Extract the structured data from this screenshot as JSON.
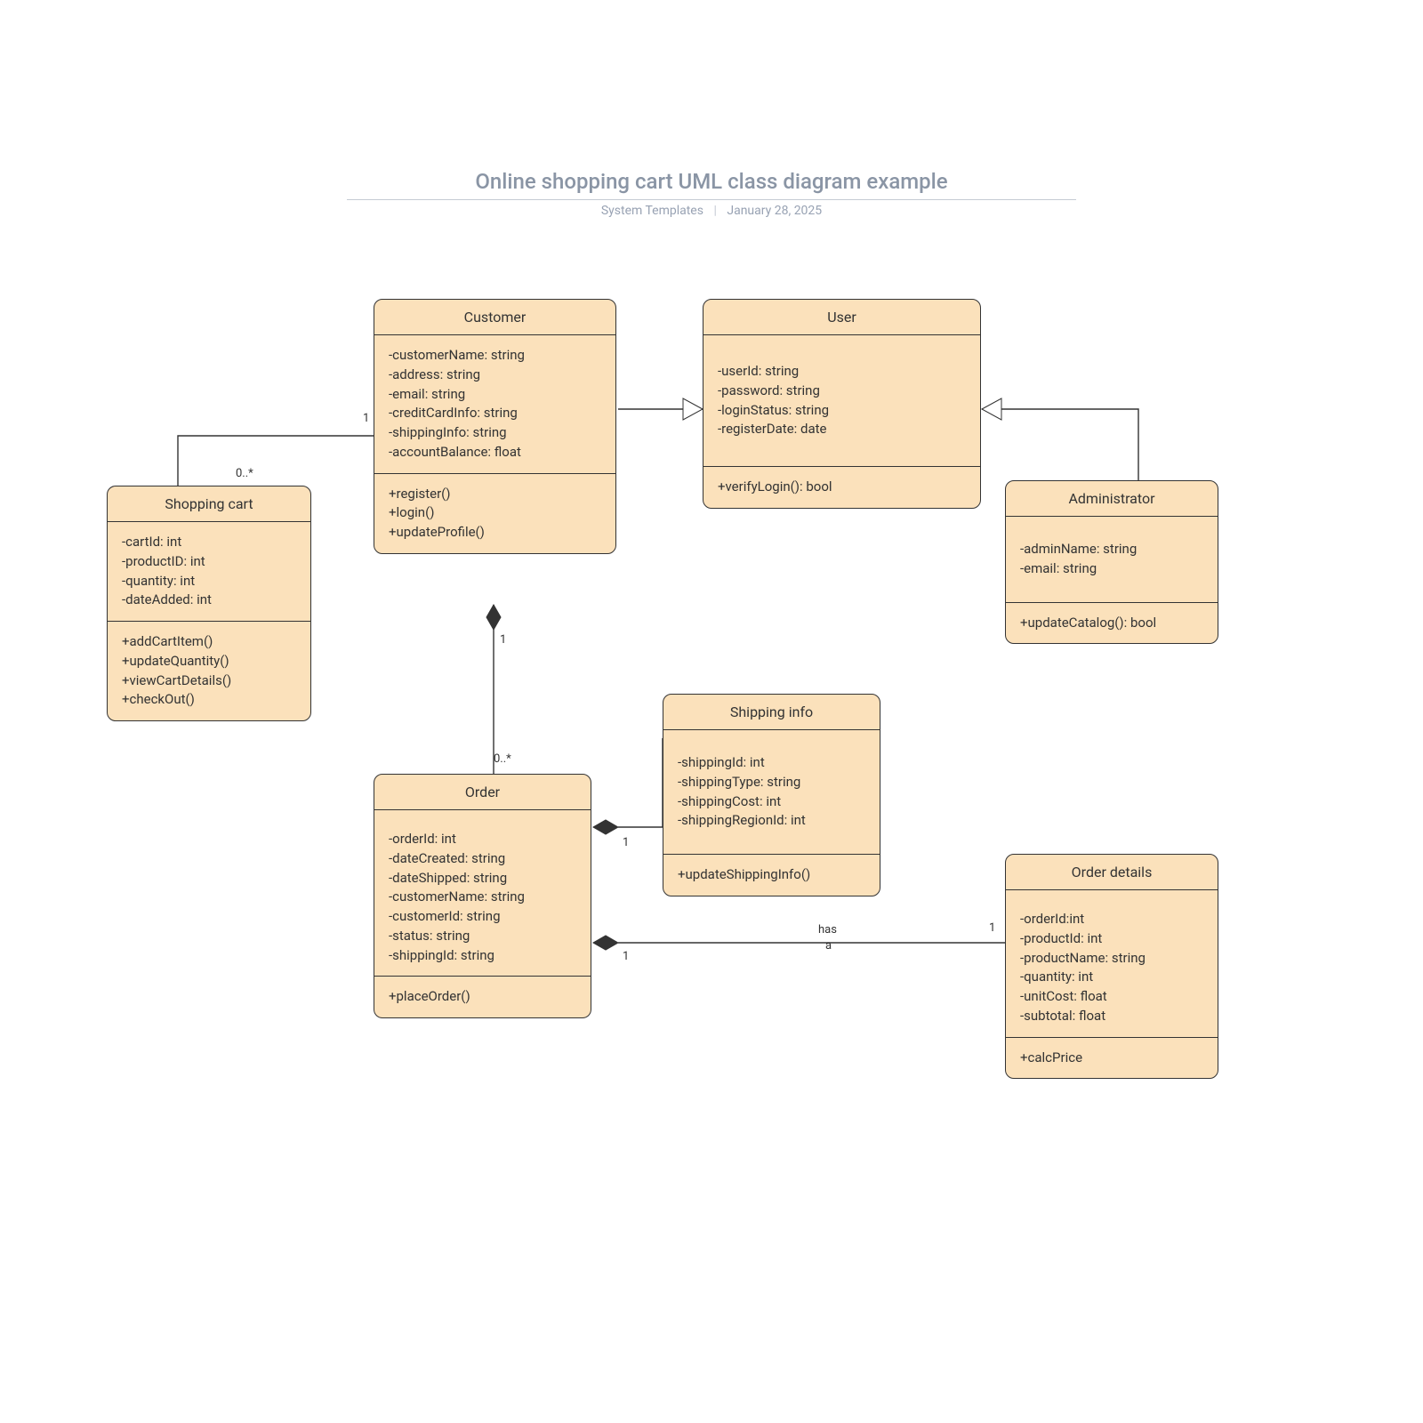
{
  "header": {
    "title": "Online shopping cart UML class diagram example",
    "author": "System Templates",
    "date": "January 28, 2025"
  },
  "classes": {
    "shoppingCart": {
      "name": "Shopping cart",
      "attrs": [
        "-cartId: int",
        "-productID: int",
        "-quantity: int",
        "-dateAdded: int"
      ],
      "ops": [
        "+addCartItem()",
        "+updateQuantity()",
        "+viewCartDetails()",
        "+checkOut()"
      ]
    },
    "customer": {
      "name": "Customer",
      "attrs": [
        "-customerName: string",
        "-address: string",
        "-email: string",
        "-creditCardInfo: string",
        "-shippingInfo: string",
        "-accountBalance: float"
      ],
      "ops": [
        "+register()",
        "+login()",
        "+updateProfile()"
      ]
    },
    "user": {
      "name": "User",
      "attrs": [
        "-userId: string",
        "-password: string",
        "-loginStatus: string",
        "-registerDate: date"
      ],
      "ops": [
        "+verifyLogin(): bool"
      ]
    },
    "administrator": {
      "name": "Administrator",
      "attrs": [
        "-adminName: string",
        "-email: string"
      ],
      "ops": [
        "+updateCatalog(): bool"
      ]
    },
    "order": {
      "name": "Order",
      "attrs": [
        "-orderId: int",
        "-dateCreated: string",
        "-dateShipped: string",
        "-customerName: string",
        "-customerId: string",
        "-status: string",
        "-shippingId: string"
      ],
      "ops": [
        "+placeOrder()"
      ]
    },
    "shippingInfo": {
      "name": "Shipping info",
      "attrs": [
        "-shippingId: int",
        "-shippingType: string",
        "-shippingCost: int",
        "-shippingRegionId: int"
      ],
      "ops": [
        "+updateShippingInfo()"
      ]
    },
    "orderDetails": {
      "name": "Order details",
      "attrs": [
        "-orderId:int",
        "-productId: int",
        "-productName: string",
        "-quantity: int",
        "-unitCost: float",
        "-subtotal: float"
      ],
      "ops": [
        "+calcPrice"
      ]
    }
  },
  "labels": {
    "m1": "1",
    "m0s": "0..*",
    "hasA1": "has",
    "hasA2": "a"
  }
}
